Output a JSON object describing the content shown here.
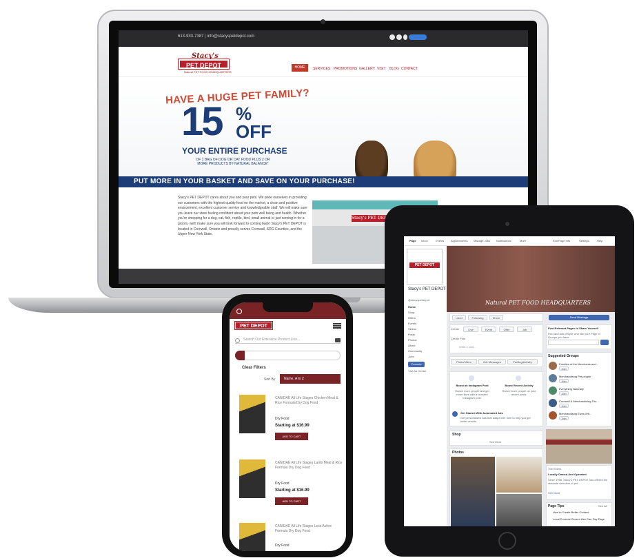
{
  "laptop": {
    "topbar_text": "613-933-7387  |  info@stacyspetdepot.com",
    "logo_script": "Stacy's",
    "logo_name": "PET DEPOT",
    "logo_tag": "Natural PET FOOD HEADQUARTERS",
    "nav": [
      "HOME",
      "SERVICES",
      "PROMOTIONS",
      "GALLERY",
      "VISIT",
      "BLOG",
      "CONTACT"
    ],
    "hero": {
      "line1": "HAVE A HUGE PET FAMILY?",
      "big_number": "15",
      "percent": "%",
      "off": "OFF",
      "line3": "YOUR ENTIRE PURCHASE",
      "line4": "OF 1 BAG OF DOG OR CAT FOOD PLUS 2 OR MORE PRODUCTS BY NATURAL BALANCE*",
      "banner": "PUT MORE IN YOUR BASKET AND SAVE ON YOUR PURCHASE!"
    },
    "about_text": "Stacy's PET DEPOT cares about you and your pets. We pride ourselves in providing our customers with the highest quality food on the market, a clean and positive environment, excellent customer service and knowledgeable staff. We will make sure you leave our store feeling confident about your pets well being and health. Whether you're shopping for a dog, cat, fish, reptile, bird, small animal or just coming in for a groom, we'll make sure you will look forward to coming back! Stacy's PET DEPOT is located in Cornwall, Ontario and proudly serves Cornwall, SDG Counties, and the Upper New York State.",
    "store_sign": "Stacy's PET DEPOT"
  },
  "tablet": {
    "fb_tabs": [
      "Page",
      "Inbox",
      "Events",
      "Appointments",
      "Manage Jobs",
      "Notifications",
      "More",
      "Edit Page Info",
      "Settings",
      "Help"
    ],
    "page_name": "Stacy's PET DEPOT",
    "page_handle": "@stacyspetdepot",
    "side_nav": [
      "Home",
      "Shop",
      "Offers",
      "Events",
      "Videos",
      "Posts",
      "Photos",
      "About",
      "Community",
      "Jobs"
    ],
    "promote_label": "Promote",
    "visit_ad_center": "Visit Ad Center",
    "cover_text": "Natural PET FOOD HEADQUARTERS",
    "action_buttons": [
      "Liked",
      "Following",
      "Share"
    ],
    "send_message": "Send Message",
    "create_row": [
      "Live",
      "Event",
      "Offer",
      "Job"
    ],
    "create_label": "Create",
    "create_post_placeholder": "Create Post",
    "write_post_placeholder": "Write a post...",
    "post_type_buttons": [
      "Photo/Video",
      "Get Messages",
      "Feeling/Activity"
    ],
    "tips": [
      {
        "title": "Boost an Instagram Post",
        "desc": "Reach more people and get more likes with a boosted Instagram post."
      },
      {
        "title": "Boost Recent Activity",
        "desc": "Reach more people on your recent posts."
      }
    ],
    "ads_title": "Get Started With Automated Ads",
    "ads_desc": "Get personalized ads that adapt over time to help you get better results.",
    "shop_label": "Shop",
    "see_more": "See More",
    "photos_label": "Photos",
    "right_title": "Find Relevant Pages to Share Yourself",
    "right_desc": "Find and add people who like your Page to Groups you have.",
    "suggested_groups": "Suggested Groups",
    "groups": [
      "Families of the Merchants and...",
      "Merchandising Pet people",
      "Everything Naturally",
      "Cornwall & Merchandising Thu...",
      "Merchandising Elves Wit..."
    ],
    "join_label": "Join",
    "right_photo_caption": "The Elders",
    "right_post_title": "Locally Owned And Operated",
    "right_post_body": "Since 1998, Stacy's PET DEPOT has offered the absolute selection of pet...",
    "page_tips": "Page Tips",
    "page_tips_see_all": "See All",
    "tip_items": [
      "How to Create Better Content",
      "Local Promote Recent Hire Can Pay Page"
    ]
  },
  "phone": {
    "logo_name": "PET DEPOT",
    "search_placeholder": "Search Our Extensive Product Line...",
    "clear_filters": "Clear Filters",
    "sort_by_label": "Sort By",
    "sort_value": "Name, A to Z",
    "products": [
      {
        "name": "CANIDAE All Life Stages Chicken Meal & Rice Formula Dry Dog Food",
        "type": "Dry Food",
        "price": "Starting at $16.99",
        "button": "ADD TO CART"
      },
      {
        "name": "CANIDAE All Life Stages Lamb Meal & Rice Formula Dry Dog Food",
        "type": "Dry Food",
        "price": "Starting at $16.99",
        "button": "ADD TO CART"
      },
      {
        "name": "CANIDAE All Life Stages Less Active Formula Dry Dog Food",
        "type": "Dry Food"
      }
    ]
  }
}
